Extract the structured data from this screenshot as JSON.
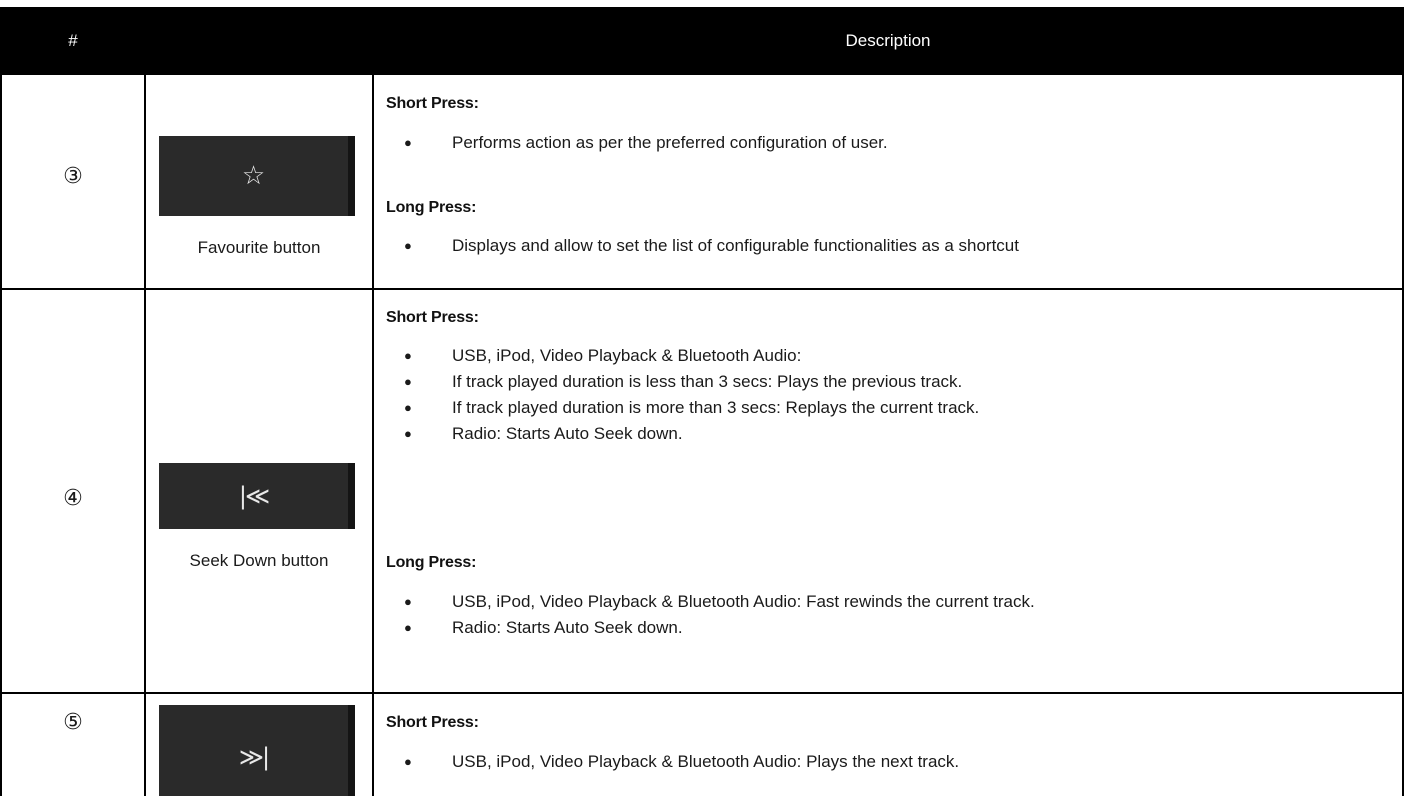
{
  "header": {
    "num_label": "#",
    "image_label": "",
    "desc_label": "Description"
  },
  "rows": [
    {
      "num": "③",
      "icon": "star-icon",
      "glyph": "☆",
      "caption": "Favourite button",
      "short_title": "Short Press:",
      "short_items": [
        "Performs action as per the preferred configuration of user."
      ],
      "long_title": "Long Press:",
      "long_items": [
        "Displays and allow to set the list of configurable functionalities as a shortcut"
      ]
    },
    {
      "num": "④",
      "icon": "seek-back-icon",
      "glyph": "|≪",
      "caption": "Seek  Down button",
      "short_title": "Short Press:",
      "short_items": [
        "USB, iPod, Video Playback & Bluetooth Audio:",
        "If track played duration is less than 3 secs: Plays the previous track.",
        "If track played duration is more than 3 secs: Replays the current track.",
        "Radio: Starts Auto Seek down."
      ],
      "long_title": "Long Press:",
      "long_items": [
        "USB, iPod, Video Playback & Bluetooth Audio: Fast rewinds the current track.",
        "Radio: Starts Auto Seek down."
      ]
    },
    {
      "num": "⑤",
      "icon": "seek-forward-icon",
      "glyph": "≫|",
      "caption": "",
      "short_title": "Short Press:",
      "short_items": [
        "USB, iPod, Video Playback & Bluetooth Audio: Plays the next track."
      ]
    }
  ]
}
